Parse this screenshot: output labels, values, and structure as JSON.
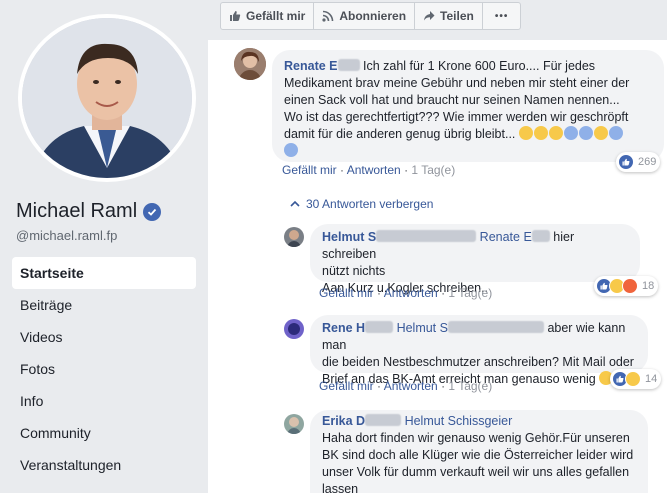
{
  "actions": {
    "like_label": "Gefällt mir",
    "subscribe_label": "Abonnieren",
    "share_label": "Teilen",
    "more_label": "•••"
  },
  "profile": {
    "name": "Michael Raml",
    "handle": "@michael.raml.fp"
  },
  "nav": {
    "items": [
      {
        "label": "Startseite",
        "active": true
      },
      {
        "label": "Beiträge"
      },
      {
        "label": "Videos"
      },
      {
        "label": "Fotos"
      },
      {
        "label": "Info"
      },
      {
        "label": "Community"
      },
      {
        "label": "Veranstaltungen"
      }
    ]
  },
  "comments": [
    {
      "author": "Renate E",
      "text_1": "Ich zahl für 1 Krone 600 Euro.... Für jedes",
      "text_2": "Medikament brav meine Gebühr und neben mir steht einer der",
      "text_3": "einen Sack voll hat und braucht nur seinen Namen nennen...",
      "text_4": "Wo ist das gerechtfertigt??? Wie immer werden wir geschröpft",
      "text_5": "damit für die anderen genug übrig bleibt...",
      "like": "Gefällt mir",
      "reply": "Antworten",
      "time": "1 Tag(e)",
      "reactions": "269"
    }
  ],
  "replies_toggle": "30 Antworten verbergen",
  "replies": [
    {
      "author": "Helmut S",
      "mention": "Renate E",
      "text_1": "hier schreiben",
      "text_2": "nützt nichts",
      "text_3": "Aan Kurz u.Kogler schreiben..",
      "like": "Gefällt mir",
      "reply": "Antworten",
      "time": "1 Tag(e)",
      "reactions": "18"
    },
    {
      "author": "Rene H",
      "mention": "Helmut S",
      "text_1": "aber wie kann man",
      "text_2": "die beiden Nestbeschmutzer anschreiben? Mit Mail oder",
      "text_3": "Brief an das BK-Amt erreicht man genauso wenig",
      "like": "Gefällt mir",
      "reply": "Antworten",
      "time": "1 Tag(e)",
      "reactions": "14"
    },
    {
      "author": "Erika D",
      "mention": "Helmut Schissgeier",
      "text_1": "Haha dort finden wir genauso wenig Gehör.Für unseren",
      "text_2": "BK sind doch alle Klüger wie die Österreicher leider wird",
      "text_3": "unser Volk für dumm verkauft weil wir uns alles gefallen",
      "text_4": "lassen"
    }
  ],
  "colors": {
    "accent": "#385898",
    "brand": "#4267b2",
    "bubble": "#f2f3f5",
    "sidebar_bg": "#e9ebee"
  }
}
